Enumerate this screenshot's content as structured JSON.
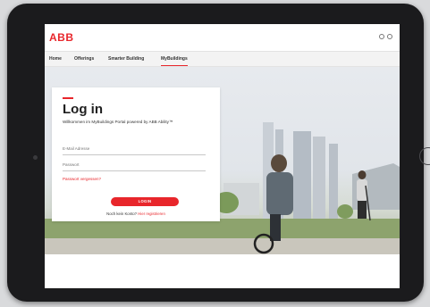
{
  "header": {
    "logo_text": "ABB",
    "nav_items": [
      "Home",
      "Offerings",
      "Smarter Building",
      "MyBuildings"
    ],
    "active_nav": "MyBuildings"
  },
  "login": {
    "title": "Log in",
    "subtitle": "Willkommen im MyBuildings Portal powered by ABB Ability™",
    "email_label": "E-Mail Adresse",
    "password_label": "Passwort",
    "forgot_password": "Passwort vergessen?",
    "submit_label": "LOGIN",
    "no_account_text": "Noch kein Konto?",
    "register_link": "Hier registrieren"
  },
  "icons": {
    "header_icons": [
      "user-icon",
      "globe-icon"
    ]
  },
  "colors": {
    "brand_red": "#e8262b",
    "device_frame": "#1b1b1d"
  }
}
